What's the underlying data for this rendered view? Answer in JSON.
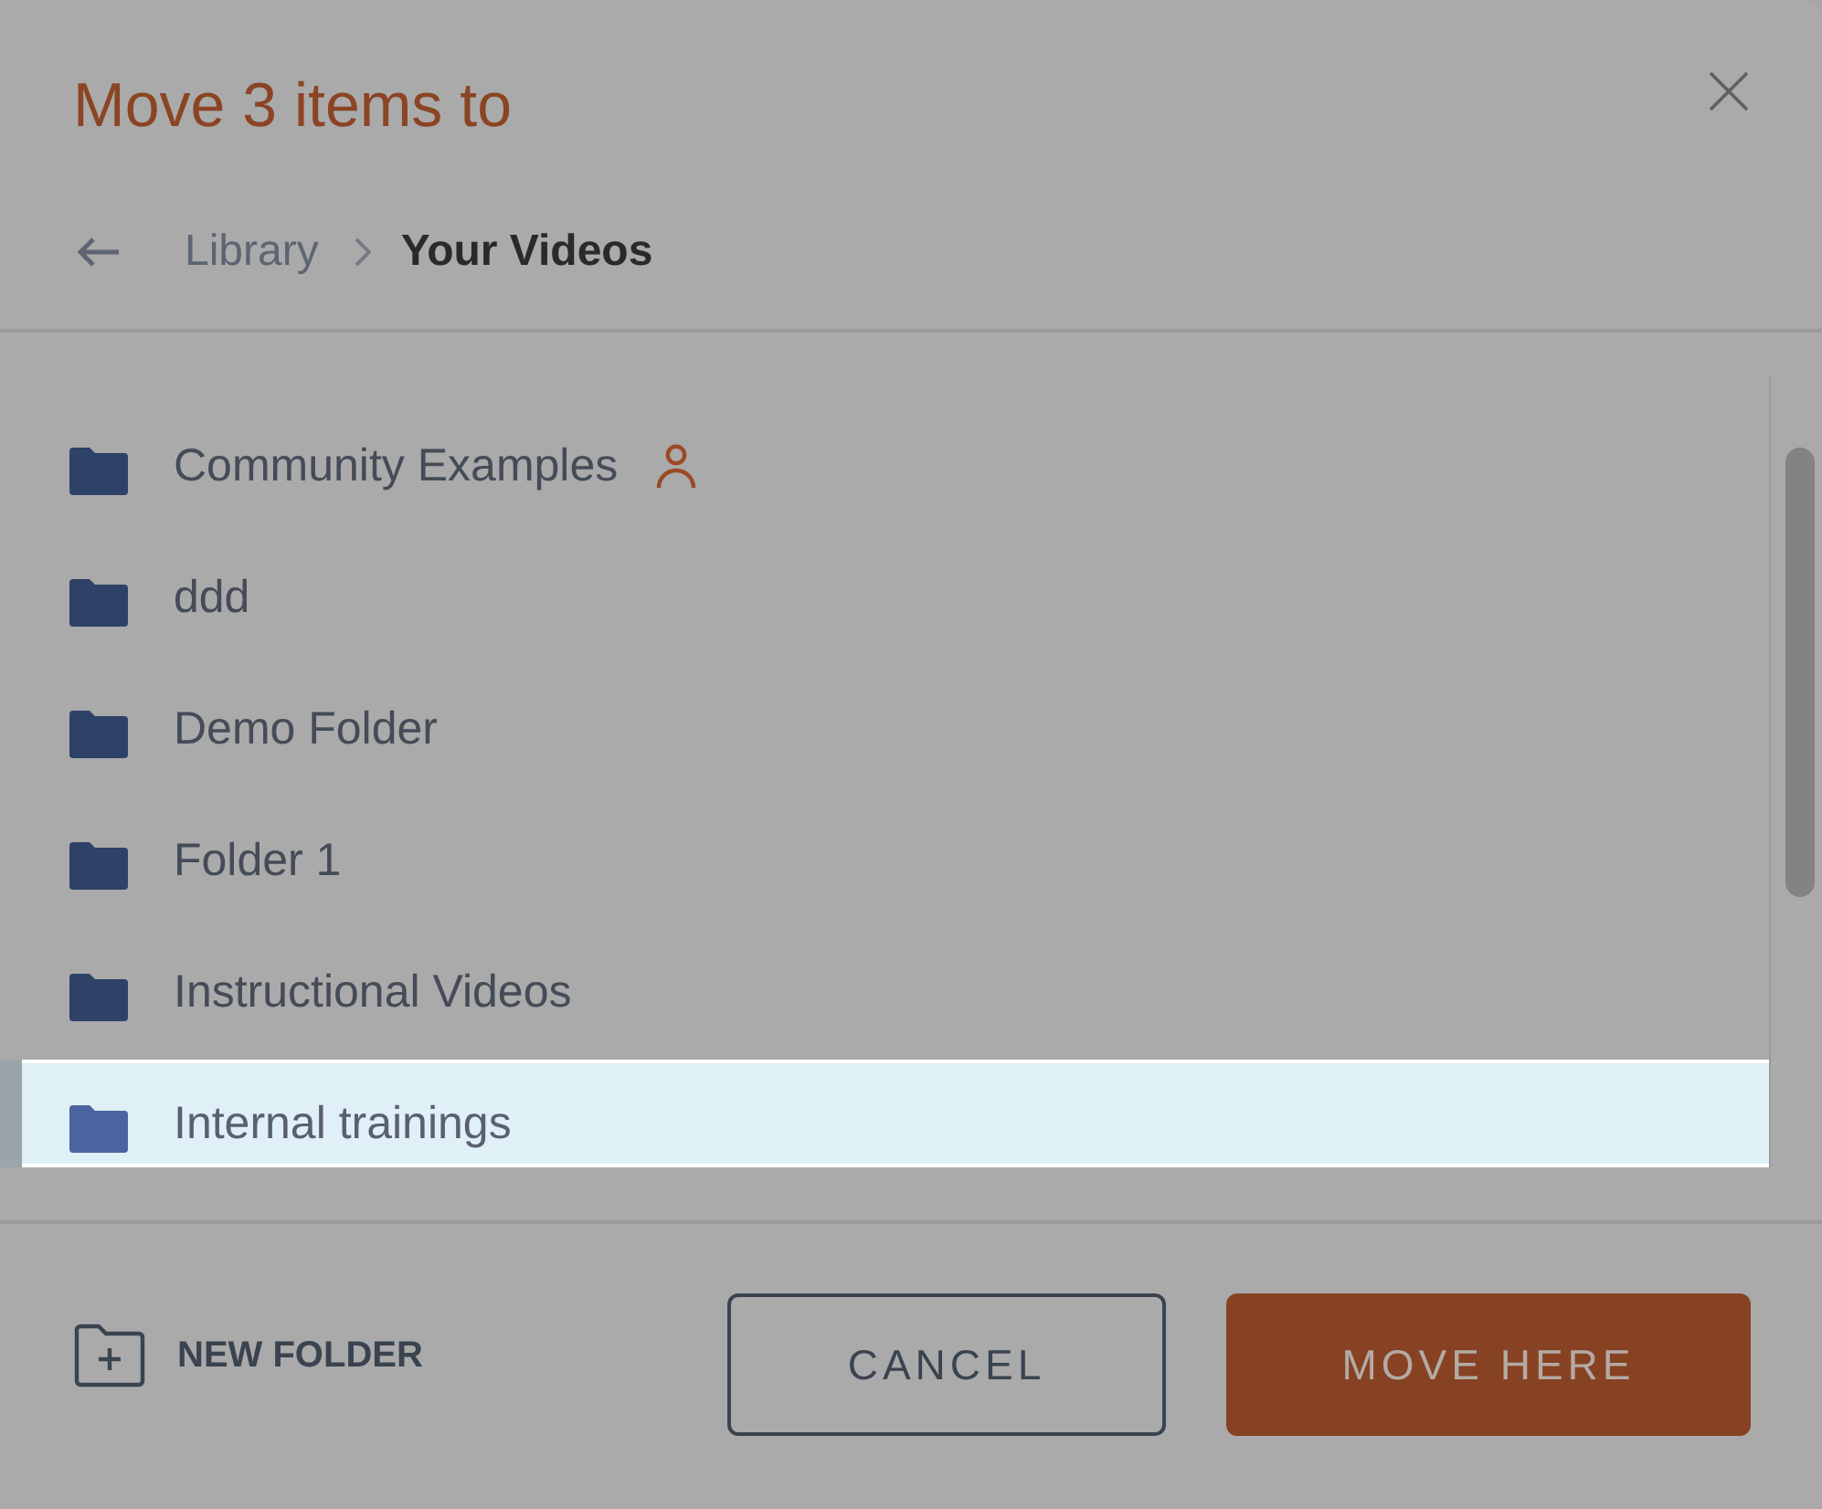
{
  "dialog": {
    "title": "Move 3 items to"
  },
  "breadcrumb": [
    {
      "label": "Library",
      "current": false
    },
    {
      "label": "Your Videos",
      "current": true
    }
  ],
  "folders": [
    {
      "name": "Community Examples",
      "shared": true,
      "selected": false
    },
    {
      "name": "ddd",
      "shared": false,
      "selected": false
    },
    {
      "name": "Demo Folder",
      "shared": false,
      "selected": false
    },
    {
      "name": "Folder 1",
      "shared": false,
      "selected": false
    },
    {
      "name": "Instructional Videos",
      "shared": false,
      "selected": false
    },
    {
      "name": "Internal trainings",
      "shared": false,
      "selected": true
    }
  ],
  "footer": {
    "new_folder": "NEW FOLDER",
    "cancel": "CANCEL",
    "confirm": "MOVE HERE"
  }
}
